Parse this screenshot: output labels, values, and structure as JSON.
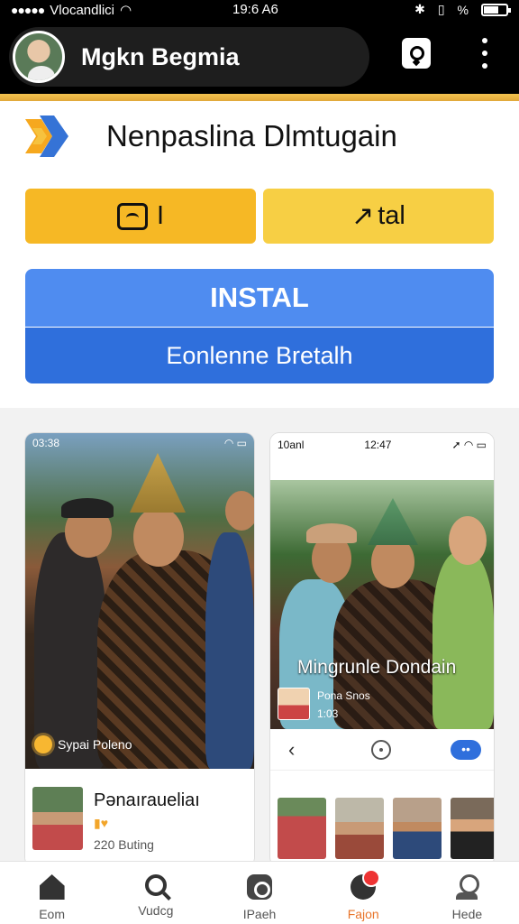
{
  "status_bar": {
    "carrier": "Vlocandlici",
    "time": "19:6 A6",
    "signal_dots": "●●●●●"
  },
  "header": {
    "title": "Mgkn Begmia"
  },
  "app": {
    "name": "Nenpaslina Dlmtugain"
  },
  "actions": {
    "primary_left_label": "I",
    "primary_right_label": "tal",
    "install_label": "INSTAL",
    "secondary_label": "Eonlenne Bretalh"
  },
  "screenshots": {
    "left": {
      "status_time": "03:38",
      "caption": "Sypai Poleno",
      "profile": {
        "name": "Pənaıraueliaı",
        "meta": "220 Buting"
      }
    },
    "right": {
      "status_left": "10anl",
      "status_time": "12:47",
      "overlay_title": "Mingrunle Dondain",
      "user_name": "Pona Snos",
      "user_meta": "1:03"
    }
  },
  "bottom_nav": {
    "items": [
      {
        "label": "Eom"
      },
      {
        "label": "Vudcg"
      },
      {
        "label": "IPaeh"
      },
      {
        "label": "Fajon"
      },
      {
        "label": "Hede"
      }
    ],
    "active_index": 3
  },
  "colors": {
    "accent_yellow": "#f6b825",
    "install_blue": "#4f8cf0",
    "secondary_blue": "#2f6fdc",
    "active_nav": "#e8742a"
  }
}
